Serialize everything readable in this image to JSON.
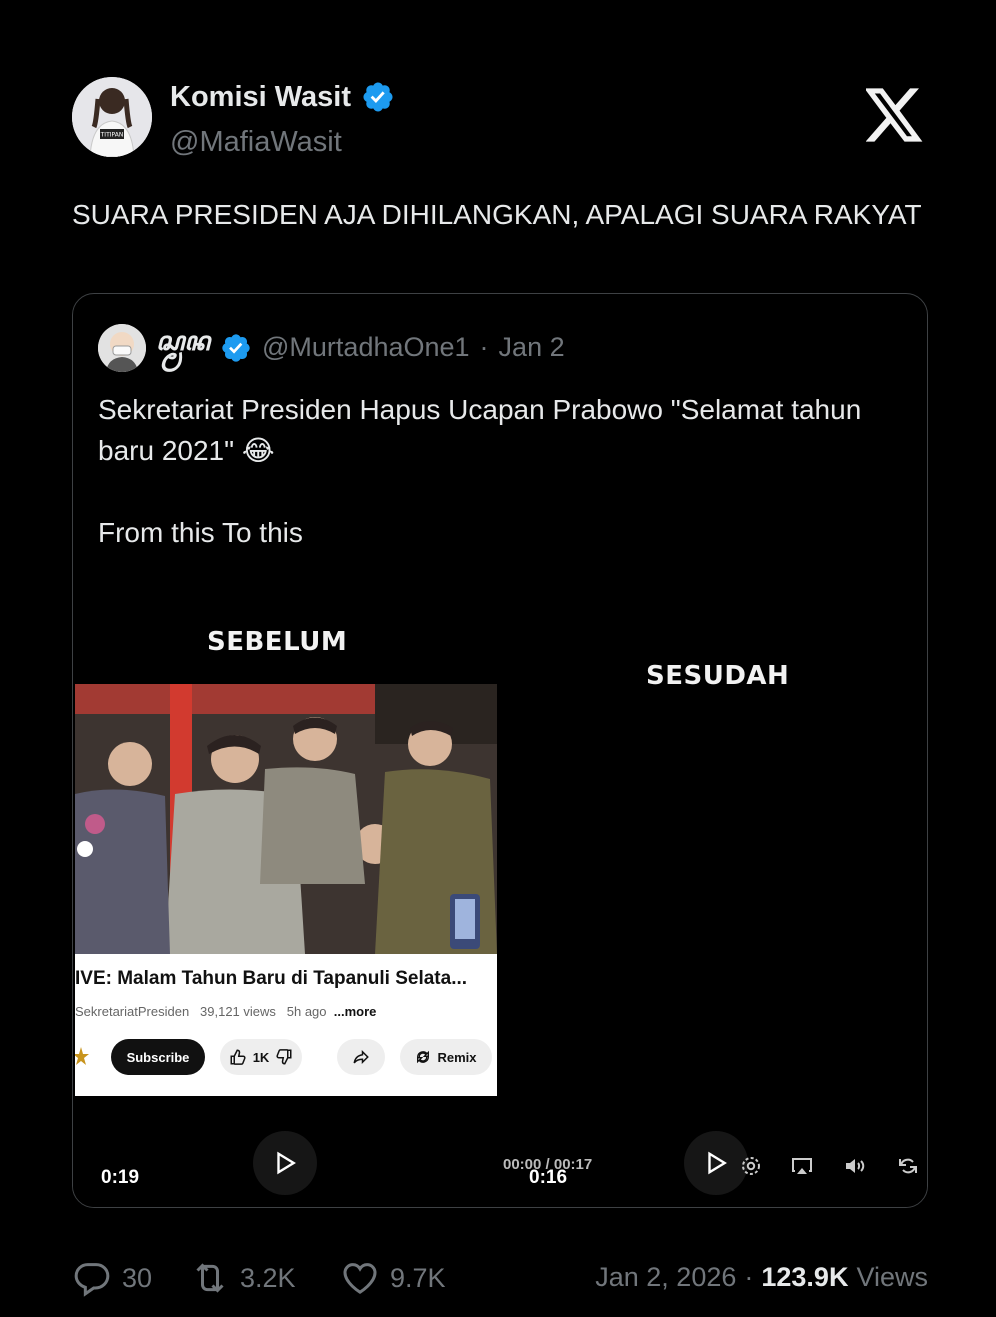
{
  "author": {
    "name": "Komisi Wasit",
    "handle": "@MafiaWasit",
    "avatar_shirt_text": "TITIPAN"
  },
  "tweet": {
    "text": "SUARA PRESIDEN AJA DIHILANGKAN, APALAGI SUARA RAKYAT"
  },
  "quote": {
    "name": "ꦱ꧀ꦩꦤ",
    "handle": "@MurtadhaOne1",
    "separator": "·",
    "date": "Jan 2",
    "line1": "Sekretariat Presiden Hapus Ucapan Prabowo \"Selamat tahun baru 2021\" 😂",
    "line2": "From this To this"
  },
  "video_left": {
    "label": "SEBELUM",
    "yt_title": "IVE: Malam Tahun Baru di Tapanuli Selata...",
    "yt_channel": "SekretariatPresiden",
    "yt_views": "39,121 views",
    "yt_ago": "5h ago",
    "yt_more": "...more",
    "subscribe": "Subscribe",
    "likes": "1K",
    "remix": "Remix",
    "duration": "0:19"
  },
  "video_right": {
    "label": "SESUDAH",
    "player_time": "00:00 / 00:17",
    "duration": "0:16"
  },
  "stats": {
    "replies": "30",
    "reposts": "3.2K",
    "likes": "9.7K"
  },
  "timestamp": {
    "date": "Jan 2, 2026",
    "separator": "·",
    "views": "123.9K",
    "views_label": "Views"
  },
  "colors": {
    "background": "#000000",
    "verified": "#1d9bf0",
    "muted": "#71767b",
    "border": "#3e4144"
  }
}
